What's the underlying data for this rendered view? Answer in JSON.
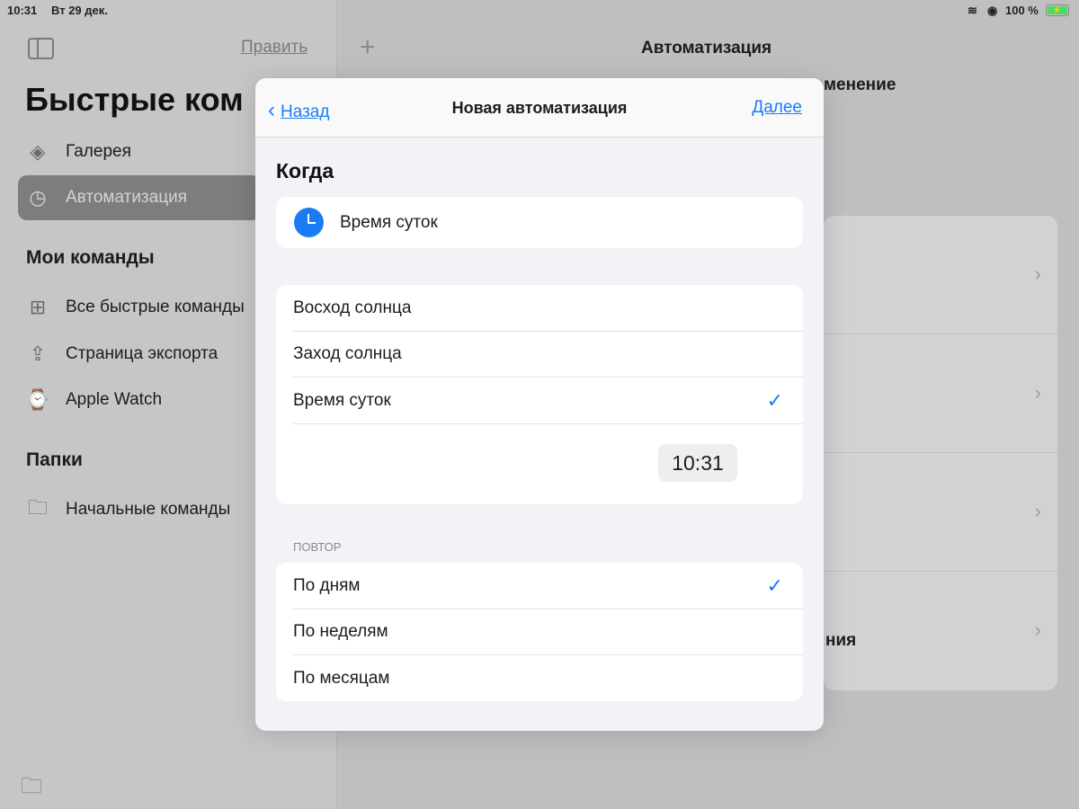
{
  "status_bar": {
    "time": "10:31",
    "date": "Вт 29 дек.",
    "battery": "100 %"
  },
  "sidebar": {
    "edit_label": "Править",
    "title": "Быстрые ком",
    "items": [
      {
        "label": "Галерея",
        "icon": "layers-icon"
      },
      {
        "label": "Автоматизация",
        "icon": "clock-icon",
        "selected": true
      }
    ],
    "my_commands_header": "Мои команды",
    "my_commands": [
      {
        "label": "Все быстрые команды",
        "icon": "grid-icon"
      },
      {
        "label": "Страница экспорта",
        "icon": "share-icon"
      },
      {
        "label": "Apple Watch",
        "icon": "watch-icon"
      }
    ],
    "folders_header": "Папки",
    "folders": [
      {
        "label": "Начальные команды",
        "icon": "folder-icon"
      }
    ]
  },
  "main": {
    "title": "Автоматизация",
    "partial_heading": "менение",
    "partial_row_text": "ния"
  },
  "modal": {
    "back_label": "Назад",
    "title": "Новая автоматизация",
    "next_label": "Далее",
    "when_header": "Когда",
    "trigger_label": "Время суток",
    "options": [
      {
        "label": "Восход солнца",
        "checked": false
      },
      {
        "label": "Заход солнца",
        "checked": false
      },
      {
        "label": "Время суток",
        "checked": true
      }
    ],
    "time_value": "10:31",
    "repeat_header": "ПОВТОР",
    "repeat_options": [
      {
        "label": "По дням",
        "checked": true
      },
      {
        "label": "По неделям",
        "checked": false
      },
      {
        "label": "По месяцам",
        "checked": false
      }
    ],
    "accent": "#1a7cf5"
  }
}
